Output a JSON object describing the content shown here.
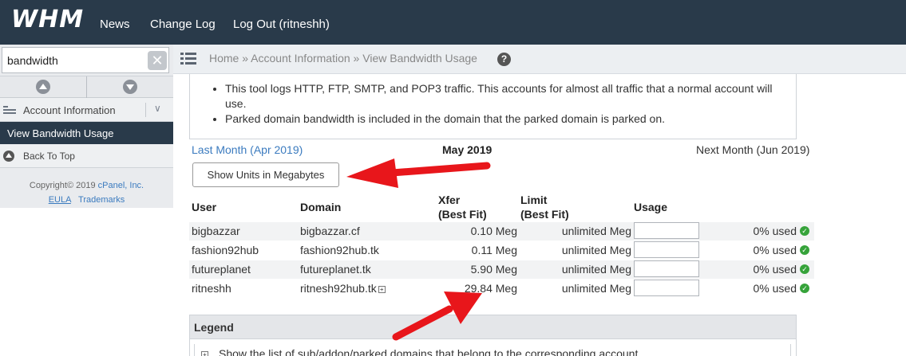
{
  "header": {
    "logo": "WHM",
    "nav": [
      "News",
      "Change Log",
      "Log Out (ritneshh)"
    ]
  },
  "sidebar": {
    "search_value": "bandwidth",
    "section": "Account Information",
    "active_item": "View Bandwidth Usage",
    "back_to_top": "Back To Top",
    "copyright": "Copyright© 2019 cPanel, Inc.",
    "copyright_link": "cPanel, Inc.",
    "copyright_prefix": "Copyright© 2019 ",
    "eula": "EULA",
    "trademarks": "Trademarks"
  },
  "breadcrumb": [
    "Home",
    "Account Information",
    "View Bandwidth Usage"
  ],
  "notes": [
    "This tool logs HTTP, FTP, SMTP, and POP3 traffic. This accounts for almost all traffic that a normal account will use.",
    "Parked domain bandwidth is included in the domain that the parked domain is parked on."
  ],
  "months": {
    "prev": "Last Month (Apr 2019)",
    "current": "May 2019",
    "next": "Next Month (Jun 2019)"
  },
  "units_button": "Show Units in Megabytes",
  "table": {
    "headers": {
      "user": "User",
      "domain": "Domain",
      "xfer_1": "Xfer",
      "xfer_2": "(Best Fit)",
      "limit_1": "Limit",
      "limit_2": "(Best Fit)",
      "usage": "Usage"
    },
    "rows": [
      {
        "user": "bigbazzar",
        "domain": "bigbazzar.cf",
        "xfer": "0.10 Meg",
        "limit": "unlimited Meg",
        "usage": "0% used"
      },
      {
        "user": "fashion92hub",
        "domain": "fashion92hub.tk",
        "xfer": "0.11 Meg",
        "limit": "unlimited Meg",
        "usage": "0% used"
      },
      {
        "user": "futureplanet",
        "domain": "futureplanet.tk",
        "xfer": "5.90 Meg",
        "limit": "unlimited Meg",
        "usage": "0% used"
      },
      {
        "user": "ritneshh",
        "domain": "ritnesh92hub.tk",
        "xfer": "29.84 Meg",
        "limit": "unlimited Meg",
        "usage": "0% used"
      }
    ]
  },
  "legend": {
    "title": "Legend",
    "item": "Show the list of sub/addon/parked domains that belong to the corresponding account."
  },
  "colors": {
    "header_bg": "#293a4a",
    "link": "#3b7bbf",
    "annotation_arrow": "#e8161b",
    "ok_check": "#36a33a"
  },
  "icons": [
    "clear-search-icon",
    "scroll-up-icon",
    "scroll-down-icon",
    "account-info-icon",
    "chevron-down-icon",
    "back-to-top-icon",
    "menu-collapse-icon",
    "help-icon",
    "expand-plus-icon",
    "check-icon"
  ]
}
